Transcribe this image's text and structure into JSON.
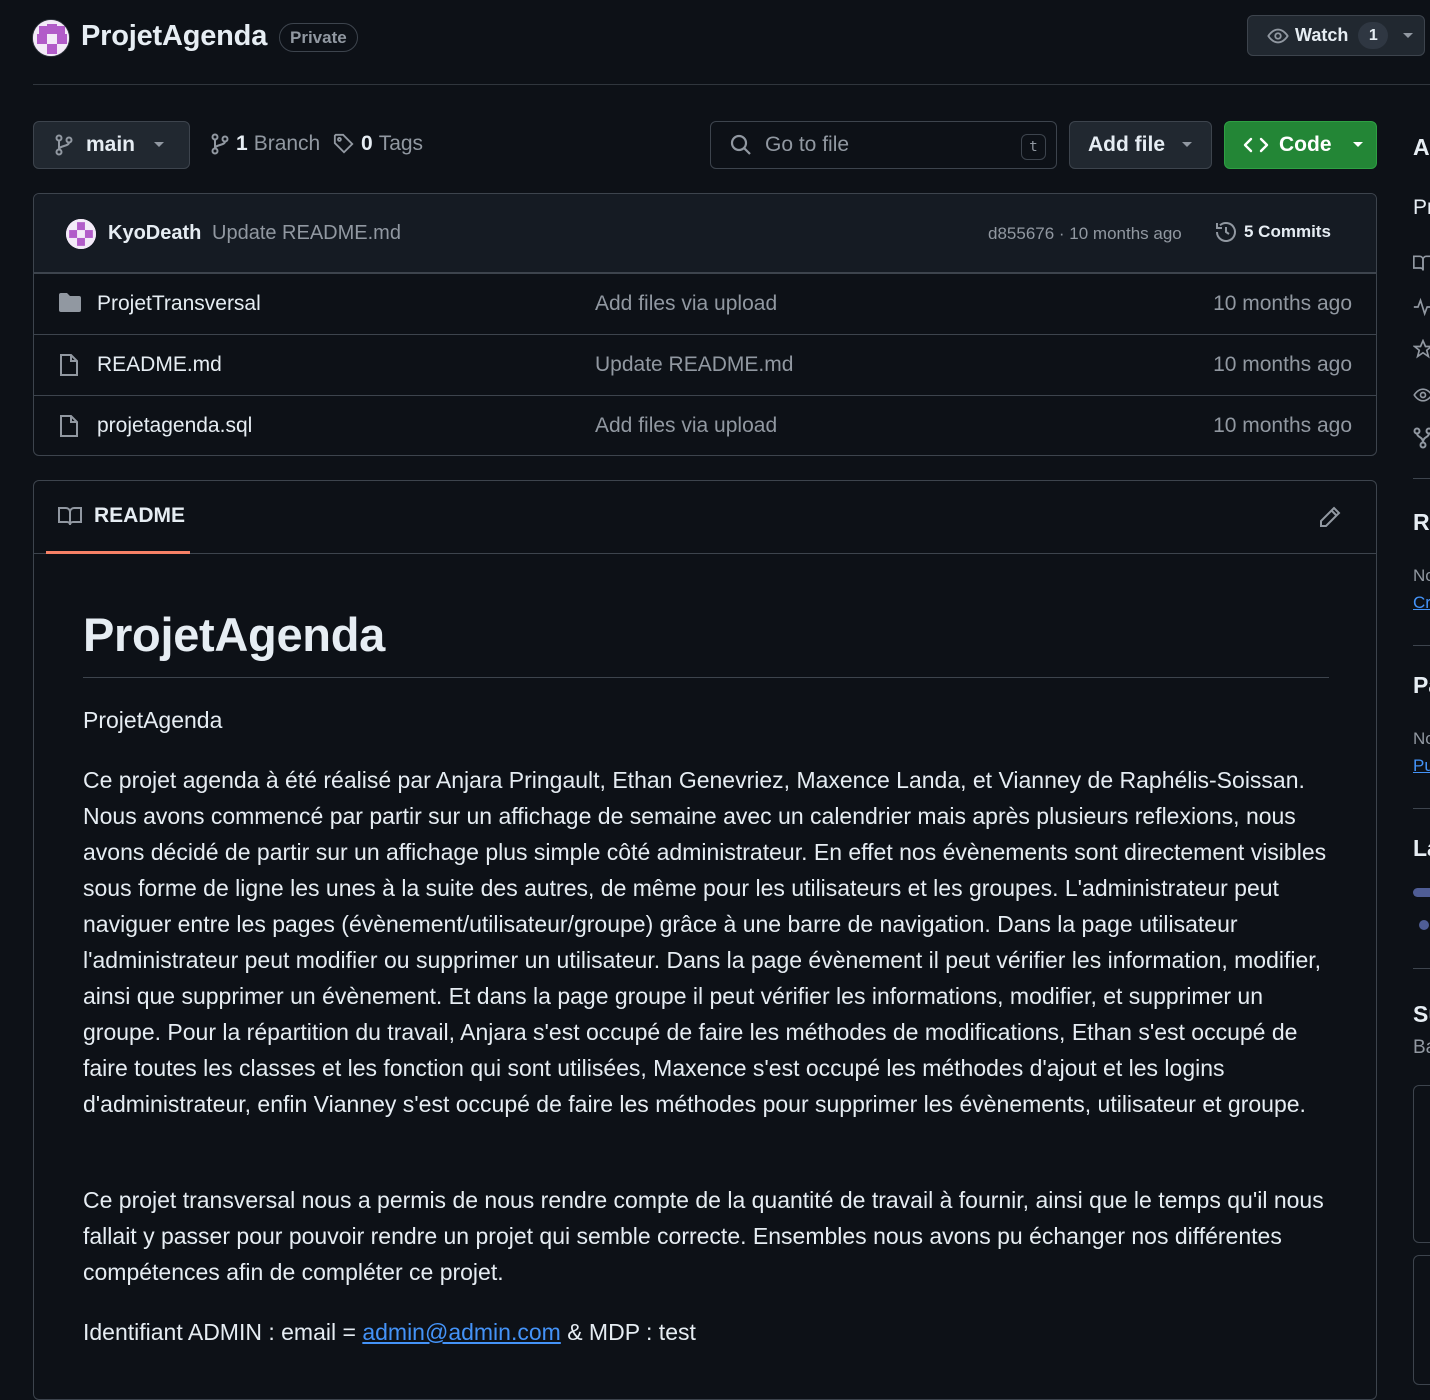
{
  "repo": {
    "name": "ProjetAgenda",
    "visibility": "Private",
    "watch_label": "Watch",
    "watch_count": "1"
  },
  "toolbar": {
    "branch": "main",
    "branch_count": "1",
    "branch_label": "Branch",
    "tag_count": "0",
    "tag_label": "Tags",
    "search_placeholder": "Go to file",
    "search_shortcut": "t",
    "add_file_label": "Add file",
    "code_label": "Code"
  },
  "latest_commit": {
    "author": "KyoDeath",
    "message": "Update README.md",
    "meta": "d855676 · 10 months ago",
    "commits_label": "5 Commits"
  },
  "files": [
    {
      "name": "ProjetTransversal",
      "type": "folder",
      "message": "Add files via upload",
      "date": "10 months ago"
    },
    {
      "name": "README.md",
      "type": "file",
      "message": "Update README.md",
      "date": "10 months ago"
    },
    {
      "name": "projetagenda.sql",
      "type": "file",
      "message": "Add files via upload",
      "date": "10 months ago"
    }
  ],
  "readme": {
    "tab_label": "README",
    "title": "ProjetAgenda",
    "p1": "ProjetAgenda",
    "p2": "Ce projet agenda à été réalisé par Anjara Pringault, Ethan Genevriez, Maxence Landa, et Vianney de Raphélis-Soissan. Nous avons commencé par partir sur un affichage de semaine avec un calendrier mais après plusieurs reflexions, nous avons décidé de partir sur un affichage plus simple côté administrateur. En effet nos évènements sont directement visibles sous forme de ligne les unes à la suite des autres, de même pour les utilisateurs et les groupes. L'administrateur peut naviguer entre les pages (évènement/utilisateur/groupe) grâce à une barre de navigation. Dans la page utilisateur l'administrateur peut modifier ou supprimer un utilisateur. Dans la page évènement il peut vérifier les information, modifier, ainsi que supprimer un évènement. Et dans la page groupe il peut vérifier les informations, modifier, et supprimer un groupe. Pour la répartition du travail, Anjara s'est occupé de faire les méthodes de modifications, Ethan s'est occupé de faire toutes les classes et les fonction qui sont utilisées, Maxence s'est occupé les méthodes d'ajout et les logins d'administrateur, enfin Vianney s'est occupé de faire les méthodes pour supprimer les évènements, utilisateur et groupe.",
    "p3": "Ce projet transversal nous a permis de nous rendre compte de la quantité de travail à fournir, ainsi que le temps qu'il nous fallait y passer pour pouvoir rendre un projet qui semble correcte. Ensembles nous avons pu échanger nos différentes compétences afin de compléter ce projet.",
    "p4_prefix": "Identifiant ADMIN : email = ",
    "p4_link": "admin@admin.com",
    "p4_suffix": " & MDP : test"
  },
  "sidebar_clipped": {
    "about": "A",
    "description_start": "Pr",
    "releases": "Re",
    "releases_text": "No",
    "releases_link": "Cr",
    "packages": "Pa",
    "packages_text": "No",
    "packages_link": "Pu",
    "languages": "La",
    "suggested": "Su",
    "suggested_text": "Ba"
  },
  "colors": {
    "background": "#0d1117",
    "border": "#3d444d",
    "code_button": "#238636",
    "link": "#4493f8",
    "tab_underline": "#f78166"
  }
}
